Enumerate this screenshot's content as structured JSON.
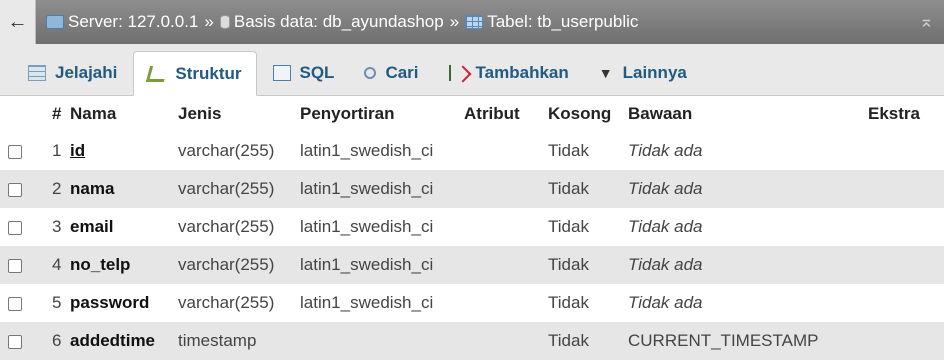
{
  "breadcrumb": {
    "server": "Server: 127.0.0.1",
    "separator": "»",
    "database": "Basis data: db_ayundashop",
    "table": "Tabel: tb_userpublic"
  },
  "tabs": [
    {
      "label": "Jelajahi",
      "icon": "browse-icon"
    },
    {
      "label": "Struktur",
      "icon": "structure-icon",
      "active": true
    },
    {
      "label": "SQL",
      "icon": "sql-icon"
    },
    {
      "label": "Cari",
      "icon": "search-icon"
    },
    {
      "label": "Tambahkan",
      "icon": "insert-icon"
    },
    {
      "label": "Lainnya",
      "icon": "dropdown-triangle-icon"
    }
  ],
  "table": {
    "headers": [
      "#",
      "Nama",
      "Jenis",
      "Penyortiran",
      "Atribut",
      "Kosong",
      "Bawaan",
      "Ekstra"
    ],
    "rows": [
      {
        "num": "1",
        "name": "id",
        "type": "varchar(255)",
        "collation": "latin1_swedish_ci",
        "attribute": "",
        "null": "Tidak",
        "default": "Tidak ada",
        "extra": ""
      },
      {
        "num": "2",
        "name": "nama",
        "type": "varchar(255)",
        "collation": "latin1_swedish_ci",
        "attribute": "",
        "null": "Tidak",
        "default": "Tidak ada",
        "extra": ""
      },
      {
        "num": "3",
        "name": "email",
        "type": "varchar(255)",
        "collation": "latin1_swedish_ci",
        "attribute": "",
        "null": "Tidak",
        "default": "Tidak ada",
        "extra": ""
      },
      {
        "num": "4",
        "name": "no_telp",
        "type": "varchar(255)",
        "collation": "latin1_swedish_ci",
        "attribute": "",
        "null": "Tidak",
        "default": "Tidak ada",
        "extra": ""
      },
      {
        "num": "5",
        "name": "password",
        "type": "varchar(255)",
        "collation": "latin1_swedish_ci",
        "attribute": "",
        "null": "Tidak",
        "default": "Tidak ada",
        "extra": ""
      },
      {
        "num": "6",
        "name": "addedtime",
        "type": "timestamp",
        "collation": "",
        "attribute": "",
        "null": "Tidak",
        "default": "CURRENT_TIMESTAMP",
        "extra": ""
      }
    ]
  }
}
